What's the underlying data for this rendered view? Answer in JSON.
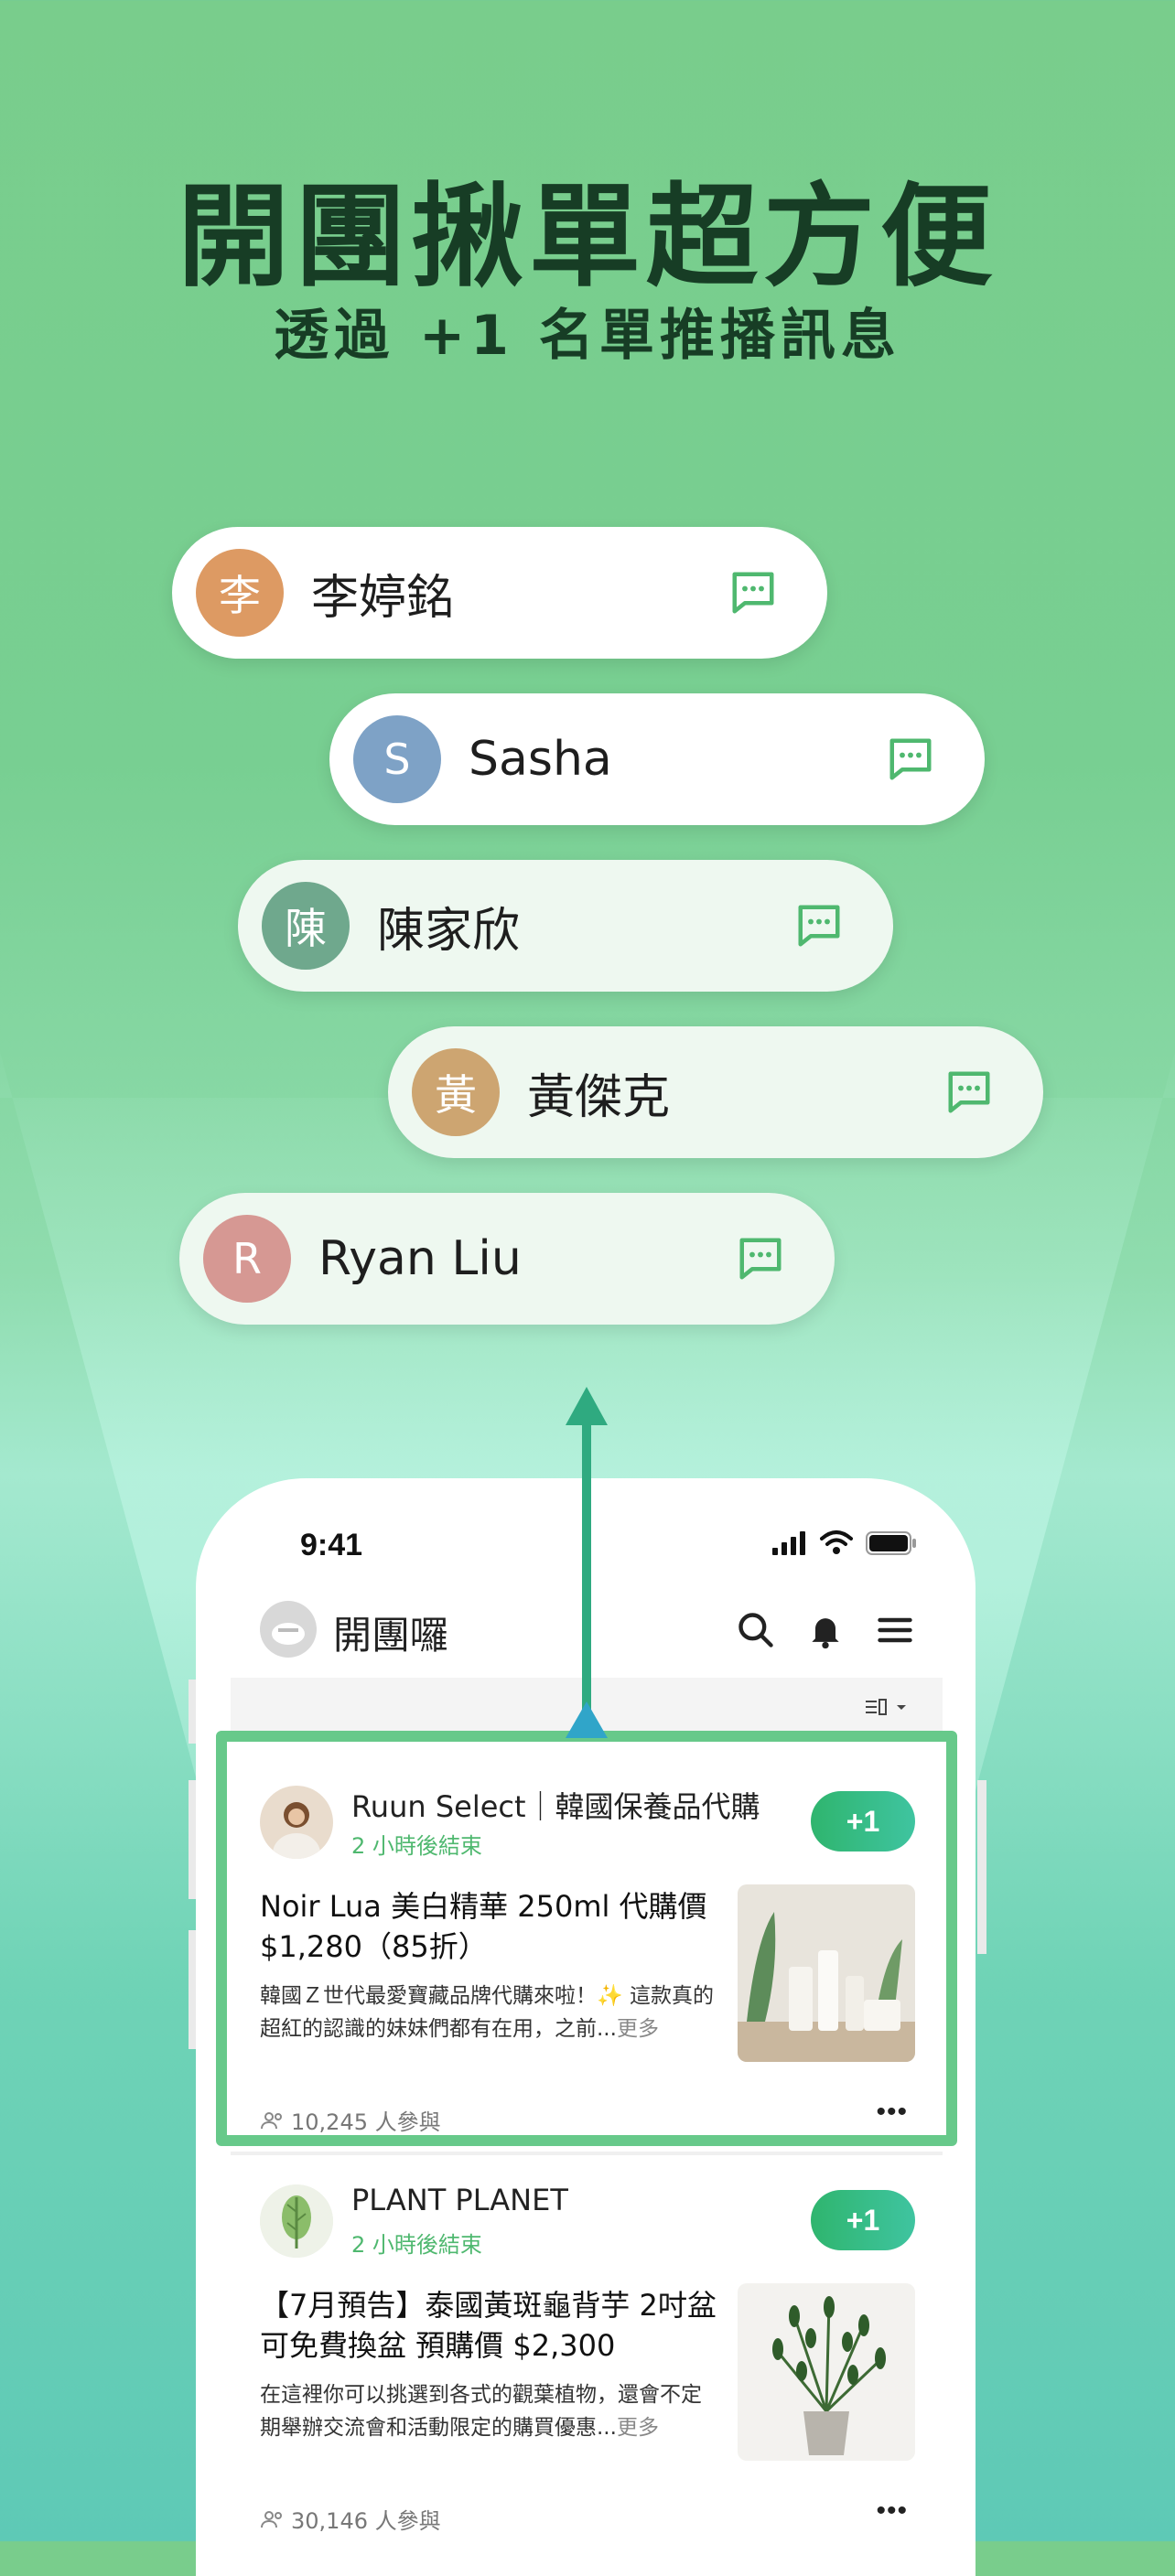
{
  "hero": {
    "headline": "開團揪單超方便",
    "subline": "透過 +1 名單推播訊息"
  },
  "contacts": [
    {
      "initial": "李",
      "name": "李婷銘",
      "color": "#dd9a63"
    },
    {
      "initial": "S",
      "name": "Sasha",
      "color": "#7ea2c6"
    },
    {
      "initial": "陳",
      "name": "陳家欣",
      "color": "#6fa88d"
    },
    {
      "initial": "黃",
      "name": "黃傑克",
      "color": "#cda571"
    },
    {
      "initial": "R",
      "name": "Ryan Liu",
      "color": "#d69893"
    }
  ],
  "phone": {
    "status_time": "9:41",
    "app_name": "開團囉",
    "posts": [
      {
        "shop": "Ruun Select｜韓國保養品代購",
        "ends": "2 小時後結束",
        "plus_label": "+1",
        "title": "Noir Lua 美白精華 250ml 代購價 $1,280（85折）",
        "desc": "韓國Ｚ世代最愛寶藏品牌代購來啦！✨ 這款真的超紅的認識的妹妹們都有在用，之前...",
        "more": "更多",
        "participants": "10,245 人參與",
        "menu": "•••"
      },
      {
        "shop": "PLANT PLANET",
        "ends": "2 小時後結束",
        "plus_label": "+1",
        "title": "【7月預告】泰國黃斑龜背芋 2吋盆可免費換盆 預購價 $2,300",
        "desc": "在這裡你可以挑選到各式的觀葉植物，還會不定期舉辦交流會和活動限定的購買優惠...",
        "more": "更多",
        "participants": "30,146 人參與",
        "menu": "•••"
      }
    ]
  },
  "colors": {
    "accent_green": "#2fb56e",
    "highlight_border": "#67c98a",
    "bg_top": "#79cd8c",
    "bg_bottom": "#5ec9b6"
  }
}
